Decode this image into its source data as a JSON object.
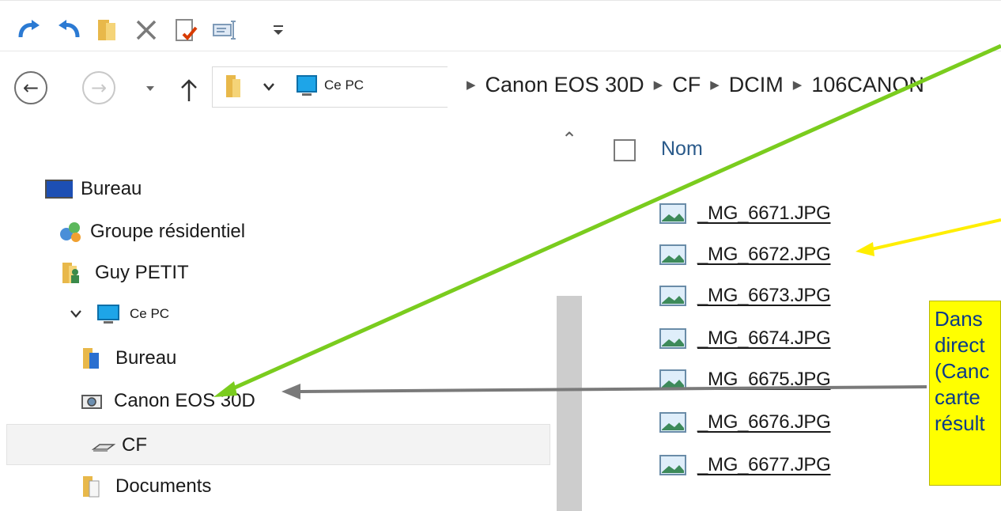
{
  "toolbar": {
    "icons": [
      "redo-icon",
      "undo-icon",
      "folder-icon",
      "delete-icon",
      "properties-icon",
      "rename-icon",
      "customize-dropdown-icon"
    ]
  },
  "navigation": {
    "back": "back-icon",
    "forward": "forward-icon",
    "recent": "recent-locations-icon",
    "up": "up-icon"
  },
  "address": {
    "root_label": "Ce PC",
    "crumbs": [
      "Canon EOS 30D",
      "CF",
      "DCIM",
      "106CANON"
    ]
  },
  "nav_tree": [
    {
      "label": "Bureau",
      "icon": "desktop-icon"
    },
    {
      "label": "Groupe résidentiel",
      "icon": "homegroup-icon"
    },
    {
      "label": "Guy PETIT",
      "icon": "user-folder-icon"
    },
    {
      "label": "Ce PC",
      "icon": "computer-icon"
    },
    {
      "label": "Bureau",
      "icon": "desktop-folder-icon"
    },
    {
      "label": "Canon EOS 30D",
      "icon": "camera-icon"
    },
    {
      "label": "CF",
      "icon": "drive-icon"
    },
    {
      "label": "Documents",
      "icon": "documents-icon"
    }
  ],
  "file_list": {
    "column_header": "Nom",
    "files": [
      "_MG_6671.JPG",
      "_MG_6672.JPG",
      "_MG_6673.JPG",
      "_MG_6674.JPG",
      "_MG_6675.JPG",
      "_MG_6676.JPG",
      "_MG_6677.JPG"
    ]
  },
  "callout": {
    "lines": [
      "Dans",
      "direct",
      "(Canc",
      "carte",
      "résult"
    ]
  },
  "colors": {
    "green_arrow": "#7acc1e",
    "yellow_arrow": "#ffee00",
    "gray_arrow": "#7a7a7a",
    "callout_bg": "#ffff00",
    "callout_text": "#0a3a8a"
  }
}
